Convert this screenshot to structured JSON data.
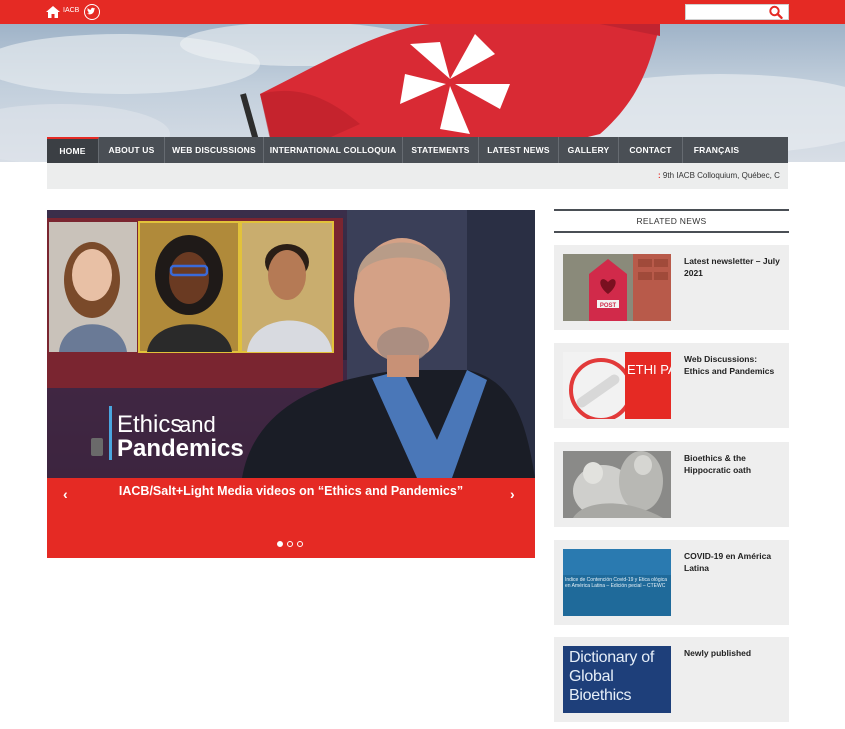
{
  "topbar": {
    "home_label": "IACB",
    "search": {
      "placeholder": "",
      "value": ""
    },
    "icons": [
      "home-icon",
      "twitter-icon",
      "search-icon"
    ],
    "color": "#e52a24"
  },
  "nav": {
    "items": [
      {
        "label": "HOME",
        "active": true
      },
      {
        "label": "ABOUT US"
      },
      {
        "label": "WEB DISCUSSIONS"
      },
      {
        "label": "INTERNATIONAL COLLOQUIA"
      },
      {
        "label": "STATEMENTS"
      },
      {
        "label": "LATEST NEWS"
      },
      {
        "label": "GALLERY"
      },
      {
        "label": "CONTACT"
      },
      {
        "label": "FRANÇAIS"
      }
    ]
  },
  "ticker": {
    "prefix": ":",
    "text": " 9th IACB Colloquium, Québec, C"
  },
  "slider": {
    "image_text_line1": "Ethics",
    "image_text_and": "and",
    "image_text_line2": "Pandemics",
    "caption": "IACB/Salt+Light Media videos on “Ethics and Pandemics”",
    "prev": "‹",
    "next": "›",
    "slide_count": 3,
    "active_slide": 1
  },
  "related": {
    "header": "RELATED NEWS",
    "items": [
      {
        "title": "Latest newsletter – July 2021"
      },
      {
        "title": "Web Discussions: Ethics and Pandemics",
        "thumb_text": "ETHI PAN"
      },
      {
        "title": "Bioethics & the Hippocratic oath"
      },
      {
        "title": "COVID-19 en América Latina",
        "thumb_text": "Índice de Contención Covid-19 y Ética ológica en América Latina – Edición pecial – CTEWC"
      },
      {
        "title": "Newly published",
        "thumb_text": "Dictionary of Global Bioethics"
      }
    ]
  }
}
